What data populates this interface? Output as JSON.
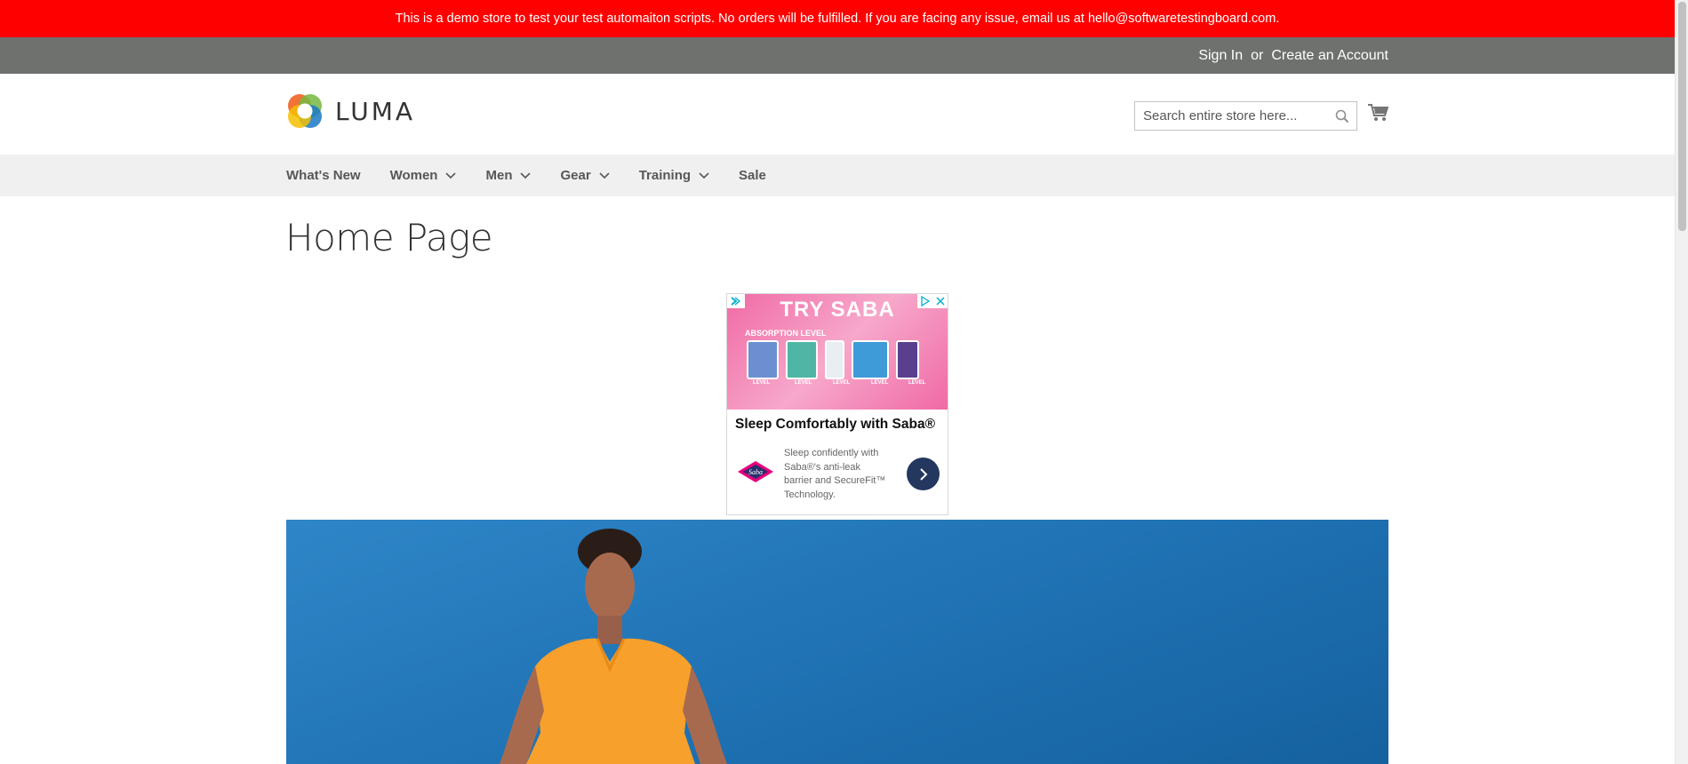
{
  "demo_notice": "This is a demo store to test your test automaiton scripts. No orders will be fulfilled. If you are facing any issue, email us at hello@softwaretestingboard.com.",
  "header_links": {
    "sign_in": "Sign In",
    "or": "or",
    "create_account": "Create an Account"
  },
  "logo": {
    "text": "LUMA"
  },
  "search": {
    "placeholder": "Search entire store here..."
  },
  "nav": {
    "items": [
      {
        "label": "What's New"
      },
      {
        "label": "Women"
      },
      {
        "label": "Men"
      },
      {
        "label": "Gear"
      },
      {
        "label": "Training"
      },
      {
        "label": "Sale"
      }
    ]
  },
  "page_title": "Home Page",
  "ad": {
    "banner_title": "TRY SABA",
    "banner_subtitle": "ABSORPTION LEVEL",
    "level_label": "LEVEL",
    "headline": "Sleep Comfortably with Saba®",
    "body": "Sleep confidently with Saba®'s anti-leak barrier and SecureFit™ Technology.",
    "brand": "Saba"
  },
  "colors": {
    "demo_bar": "#ff0000",
    "top_bar": "#6e716e",
    "nav_bg": "#f0f0f0",
    "hero": "#1d6fb0"
  }
}
